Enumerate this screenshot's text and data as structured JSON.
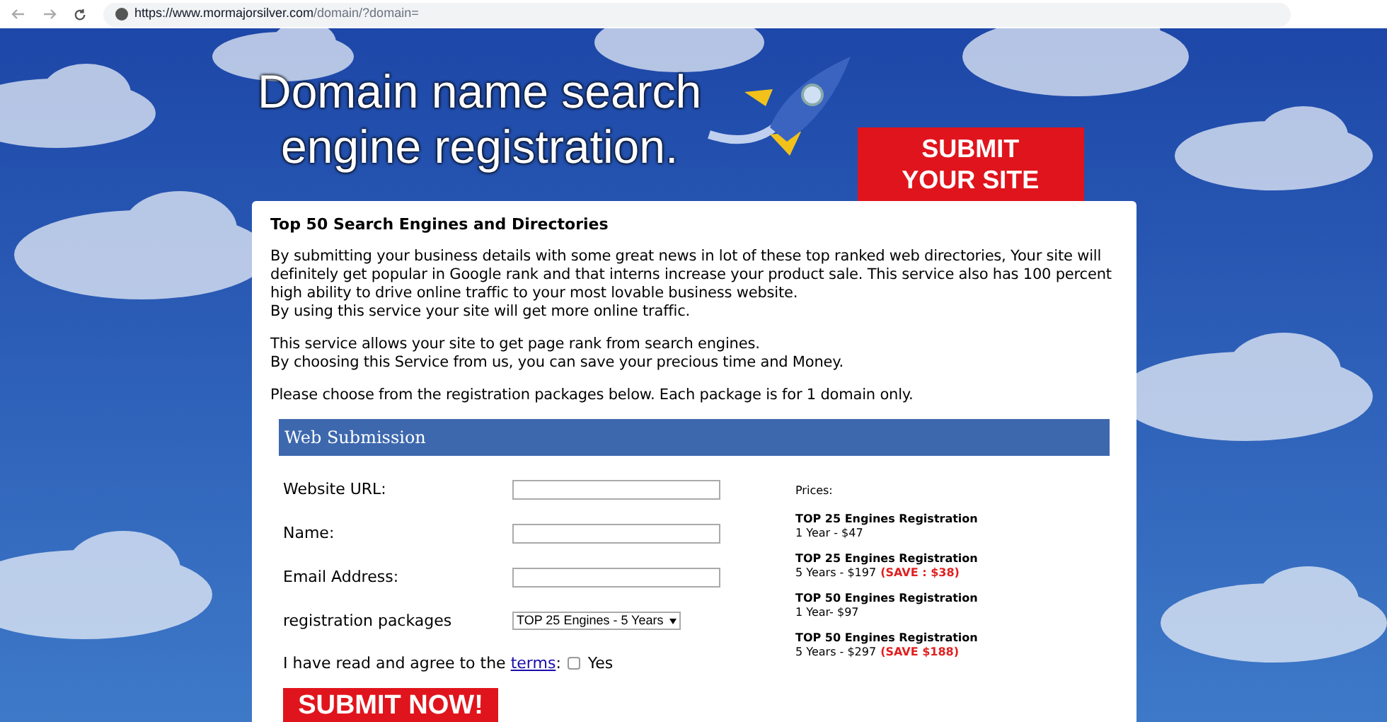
{
  "browser": {
    "url_host": "https://www.mormajorsilver.com",
    "url_path": "/domain/?domain="
  },
  "hero": {
    "headline_lines": [
      "Domain name search",
      "engine registration."
    ],
    "cta_lines": [
      "SUBMIT",
      "YOUR SITE"
    ]
  },
  "content": {
    "title": "Top 50 Search Engines and Directories",
    "paragraphs": [
      [
        "By submitting your business details with some great news in lot of these top ranked web directories, Your site will definitely get popular in Google rank and that interns increase your product sale. This service also has 100 percent high ability to drive online traffic to your most lovable business website.",
        "By using this service your site will get more online traffic."
      ],
      [
        "This service allows your site to get page rank from search engines.",
        "By choosing this Service from us, you can save your precious time and Money."
      ],
      [
        "Please choose from the registration packages below. Each package is for 1 domain only."
      ]
    ]
  },
  "form": {
    "header": "Web Submission",
    "fields": [
      {
        "kind": "text",
        "label": "Website URL:"
      },
      {
        "kind": "text",
        "label": "Name:"
      },
      {
        "kind": "text",
        "label": "Email Address:"
      },
      {
        "kind": "select",
        "label": "registration packages",
        "value": "TOP 25 Engines - 5 Years"
      }
    ],
    "terms": {
      "text": "I have read and agree to the",
      "link": "terms",
      "suffix": ":",
      "checked": false,
      "option": "Yes"
    },
    "submit": "SUBMIT NOW!",
    "prices_label": "Prices:",
    "prices": [
      {
        "name": "TOP 25 Engines Registration",
        "detail": "1 Year - $47"
      },
      {
        "name": "TOP 25 Engines Registration",
        "detail": "5 Years - $197",
        "save": "(SAVE : $38)"
      },
      {
        "name": "TOP 50 Engines Registration",
        "detail": "1 Year- $97"
      },
      {
        "name": "TOP 50 Engines Registration",
        "detail": "5 Years - $297",
        "save": "(SAVE $188)"
      }
    ]
  }
}
